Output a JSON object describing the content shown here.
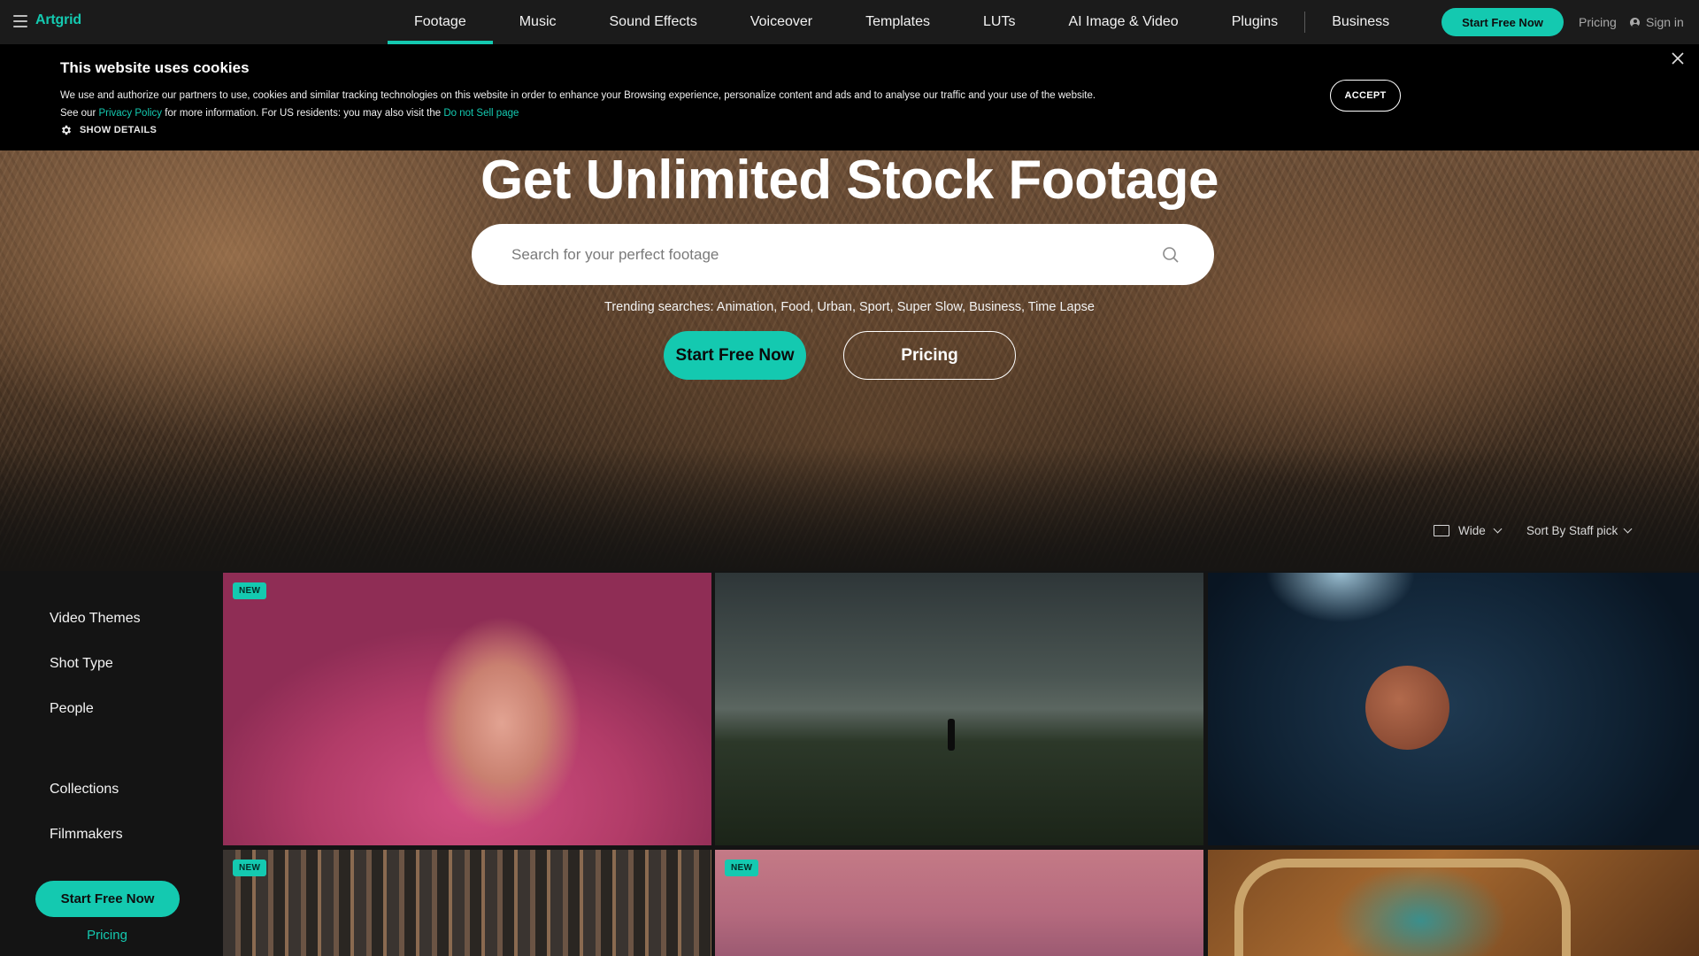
{
  "nav": {
    "logo": "Artgrid",
    "links": [
      "Footage",
      "Music",
      "Sound Effects",
      "Voiceover",
      "Templates",
      "LUTs",
      "AI Image & Video",
      "Plugins"
    ],
    "business": "Business",
    "cta": "Start Free Now",
    "pricing": "Pricing",
    "signin": "Sign in"
  },
  "cookie": {
    "title": "This website uses cookies",
    "text_1": "We use and authorize our partners to use, cookies and similar tracking technologies on this website in order to enhance your Browsing experience, personalize content and ads and to analyse our traffic and your use of the website. See our ",
    "privacy_link": "Privacy Policy",
    "text_2": " for more information. For US residents: you may also visit the ",
    "dns_link": "Do not Sell page",
    "show_details": "SHOW DETAILS",
    "accept": "ACCEPT"
  },
  "hero": {
    "title": "Get Unlimited Stock Footage",
    "search_placeholder": "Search for your perfect footage",
    "trending": "Trending searches: Animation, Food, Urban, Sport, Super Slow, Business, Time Lapse",
    "cta": "Start Free Now",
    "pricing": "Pricing"
  },
  "view": {
    "layout": "Wide",
    "sort": "Sort By Staff pick"
  },
  "sidebar": {
    "items": [
      "Video Themes",
      "Shot Type",
      "People",
      "Collections",
      "Filmmakers"
    ],
    "cta": "Start Free Now",
    "pricing": "Pricing"
  },
  "grid": {
    "badge": "NEW",
    "tiles": [
      {
        "subject": "woman-in-pink-water",
        "new": true
      },
      {
        "subject": "storm-over-field",
        "new": false
      },
      {
        "subject": "basketball-players-underwater",
        "new": false
      },
      {
        "subject": "city-aerial",
        "new": true
      },
      {
        "subject": "pink-sky",
        "new": true
      },
      {
        "subject": "girl-in-car-window",
        "new": false
      }
    ]
  },
  "colors": {
    "accent": "#14c9b0",
    "nav_bg": "#1b1b1b",
    "page_bg": "#141414"
  }
}
